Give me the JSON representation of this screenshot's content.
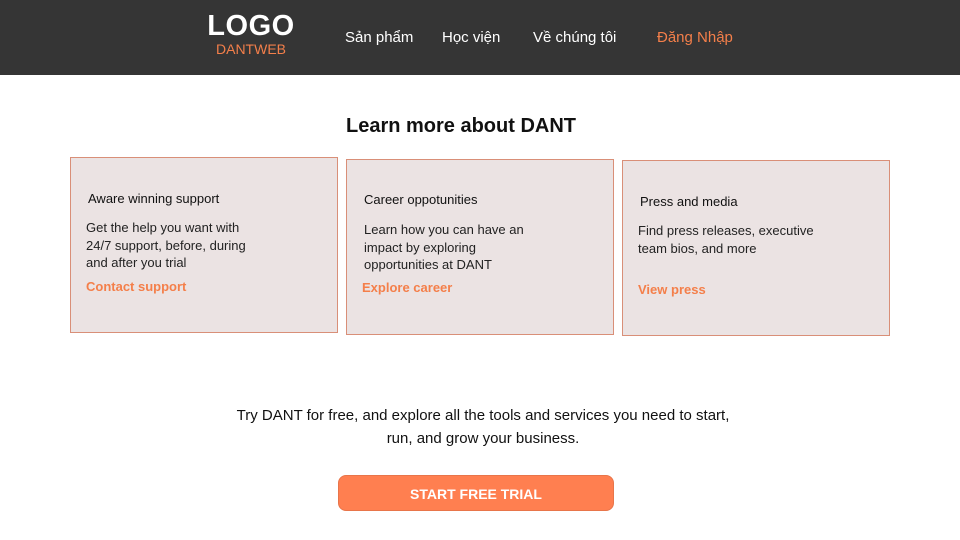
{
  "header": {
    "logo_main": "LOGO",
    "logo_sub": "DANTWEB",
    "nav": [
      "Sản phẩm",
      "Học viện",
      "Về chúng tôi"
    ],
    "login_label": "Đăng Nhập"
  },
  "main": {
    "title": "Learn more about DANT",
    "cards": [
      {
        "title": "Aware winning support",
        "body": [
          "Get the help you want with",
          "24/7 support, before, during",
          "and after you trial"
        ],
        "link": "Contact support"
      },
      {
        "title": "Career oppotunities",
        "body": [
          "Learn how you can have an",
          "impact by exploring",
          "opportunities at DANT"
        ],
        "link": "Explore career"
      },
      {
        "title": "Press and media",
        "body": [
          "Find press releases, executive",
          "team bios, and more"
        ],
        "link": "View press"
      }
    ]
  },
  "cta": {
    "line1": "Try DANT for free, and explore all the tools and services you need to start,",
    "line2": "run, and grow your business.",
    "button_label": "START FREE TRIAL"
  },
  "colors": {
    "header_bg": "#353535",
    "accent": "#ff7f50",
    "card_bg": "#ebe3e3",
    "card_border": "#d98f78"
  }
}
